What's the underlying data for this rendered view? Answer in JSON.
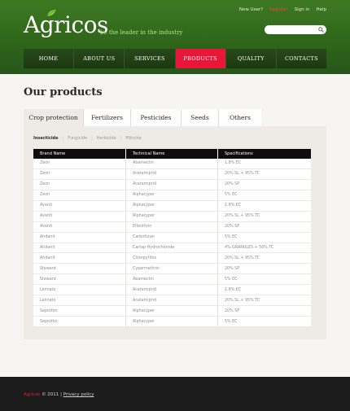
{
  "header": {
    "logo": "Agricos",
    "tagline": "be the leader in the industry",
    "top_links": [
      "New User?",
      "Register",
      "Sign in",
      "Help"
    ],
    "search": {
      "placeholder": ""
    }
  },
  "nav": [
    "HOME",
    "ABOUT US",
    "SERVICES",
    "PRODUCTS",
    "QUALITY",
    "CONTACTS"
  ],
  "nav_active": "PRODUCTS",
  "main": {
    "title": "Our products",
    "tabs": [
      "Crop protection",
      "Fertilizers",
      "Pesticides",
      "Seeds",
      "Others"
    ],
    "subtabs": [
      "Insecticide",
      "Fungicide",
      "Herbicide",
      "Miticide"
    ],
    "table": {
      "headers": [
        "Brand Name",
        "Technical Name",
        "Specifications"
      ],
      "rows": [
        [
          "Zeon",
          "Abamectin",
          "1.8% EC"
        ],
        [
          "Zeon",
          "Acetamiprid",
          "20% SL + 95% TC"
        ],
        [
          "Zeon",
          "Acetamiprid",
          "20% SP"
        ],
        [
          "Zeon",
          "Alphacyper",
          "5% EC"
        ],
        [
          "Avanti",
          "Alphacyper",
          "1.8% EC"
        ],
        [
          "Avanti",
          "Alphacyper",
          "20% SL + 95% TC"
        ],
        [
          "Avanti",
          "Elfenthrin",
          "20% SP"
        ],
        [
          "Ahdanit",
          "Carbofuran",
          "5% EC"
        ],
        [
          "Ahdanit",
          "Cartap Hydrochloride",
          "4% GRANULES + 50% TC"
        ],
        [
          "Ahdanit",
          "Chlorpyrifos",
          "20% SL + 95% TC"
        ],
        [
          "Steward",
          "Cypermethrin",
          "20% SP"
        ],
        [
          "Steward",
          "Abamectin",
          "5% EC"
        ],
        [
          "Lennato",
          "Acetamiprid",
          "1.8% EC"
        ],
        [
          "Lennato",
          "Acetamiprid",
          "20% SL + 95% TC"
        ],
        [
          "Seprofon",
          "Alphacyper",
          "20% SP"
        ],
        [
          "Seprofon",
          "Alphacyper",
          "5% EC"
        ]
      ]
    }
  },
  "footer": {
    "brand": "Agricos",
    "copyright": "© 2011",
    "separator": "|",
    "policy": "Privacy policy"
  },
  "colors": {
    "accent": "#e8173a",
    "header_green": "#2f661a",
    "nav_dark": "#1f3f14"
  }
}
